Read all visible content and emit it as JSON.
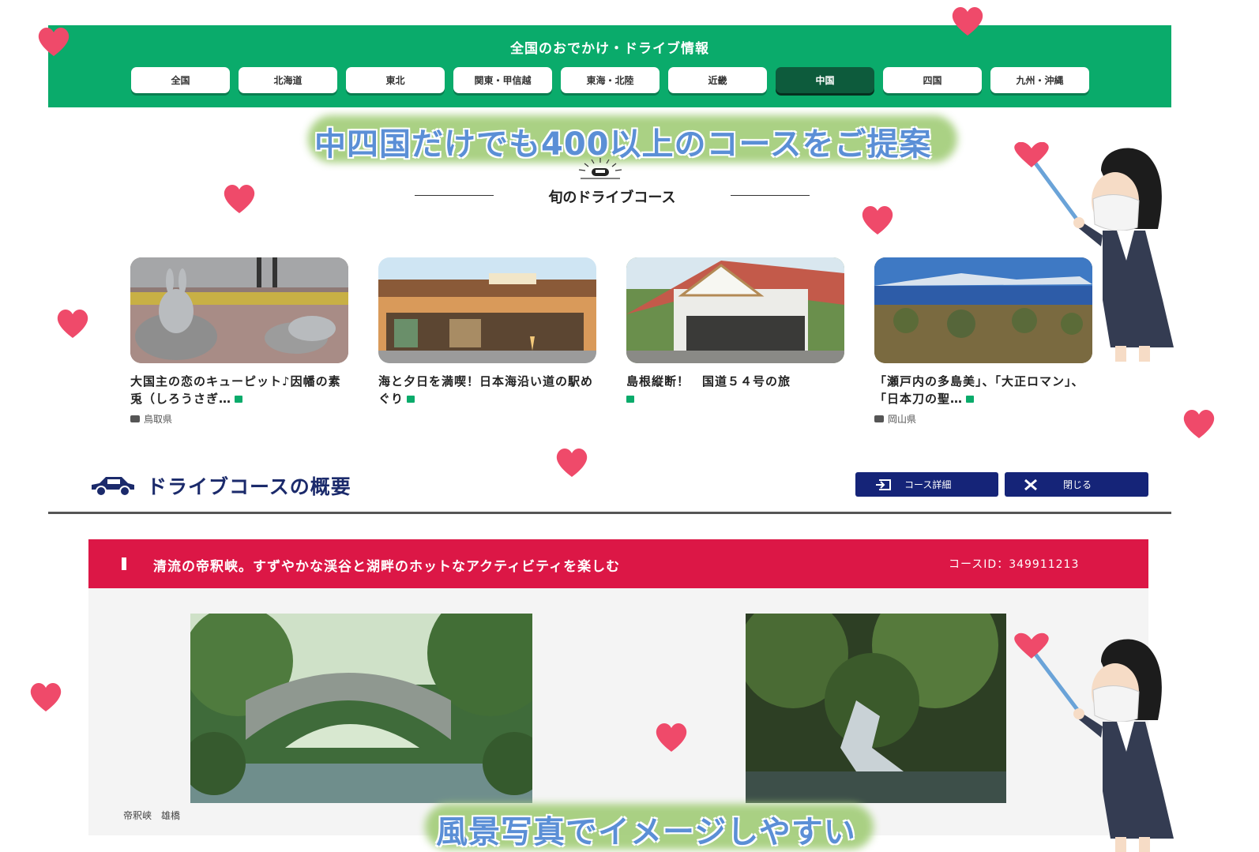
{
  "header": {
    "title": "全国のおでかけ・ドライブ情報",
    "regions": [
      {
        "label": "全国",
        "active": false
      },
      {
        "label": "北海道",
        "active": false
      },
      {
        "label": "東北",
        "active": false
      },
      {
        "label": "関東・甲信越",
        "active": false
      },
      {
        "label": "東海・北陸",
        "active": false
      },
      {
        "label": "近畿",
        "active": false
      },
      {
        "label": "中国",
        "active": true
      },
      {
        "label": "四国",
        "active": false
      },
      {
        "label": "九州・沖縄",
        "active": false
      }
    ]
  },
  "captions": {
    "top": "中四国だけでも400以上のコースをご提案",
    "bottom": "風景写真でイメージしやすい"
  },
  "seasonal": {
    "heading": "旬のドライブコース"
  },
  "cards": [
    {
      "title": "大国主の恋のキューピット♪因幡の素兎（しろうさぎ…",
      "location": "鳥取県"
    },
    {
      "title": "海と夕日を満喫！日本海沿い道の駅めぐり",
      "location": ""
    },
    {
      "title": "島根縦断！　国道５４号の旅",
      "location": ""
    },
    {
      "title": "「瀬戸内の多島美」、「大正ロマン」、「日本刀の聖…",
      "location": "岡山県"
    }
  ],
  "overview": {
    "title": "ドライブコースの概要",
    "detail_button": "コース詳細",
    "close_button": "閉じる"
  },
  "course": {
    "title": "清流の帝釈峡。すずやかな渓谷と湖畔のホットなアクティビティを楽しむ",
    "id_label": "コースID：349911213",
    "photos": [
      {
        "caption": "帝釈峡　雄橋"
      },
      {
        "caption": ""
      }
    ]
  },
  "colors": {
    "header_green": "#0aab6b",
    "active_tab": "#0d5b3c",
    "navy": "#152478",
    "crimson": "#dc1746",
    "caption_blue": "#5b8fd6"
  }
}
